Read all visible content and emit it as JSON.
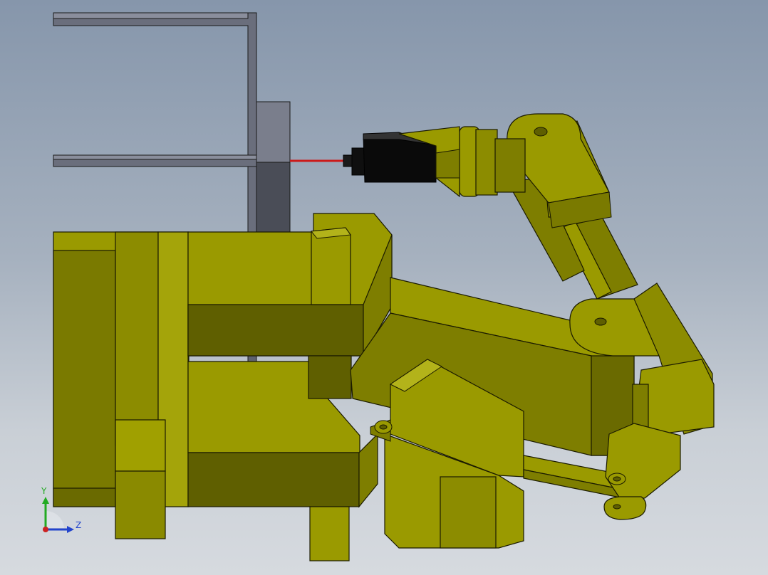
{
  "colors": {
    "background_top": "#8696ab",
    "background_bottom": "#d6dadf",
    "part_light": "#9a9a00",
    "part_mid": "#7e7e00",
    "part_dark": "#5f5f00",
    "part_highlight": "#b3b31a",
    "fixture_light": "#7a7e8c",
    "fixture_dark": "#4a4d57",
    "frame": "#5e6270",
    "sensor_body": "#0a0a0a",
    "laser_beam": "#cc1a1a",
    "edge": "#1a1a00"
  },
  "triad": {
    "x_axis_color": "#2244cc",
    "y_axis_color": "#22aa22",
    "y_label": "Y",
    "z_label": "Z"
  },
  "scene_parts": [
    "rectangular-frame",
    "fixture-block",
    "laser-sensor",
    "base-housing",
    "lower-arm",
    "upper-arm",
    "wrist-joint",
    "end-effector"
  ]
}
